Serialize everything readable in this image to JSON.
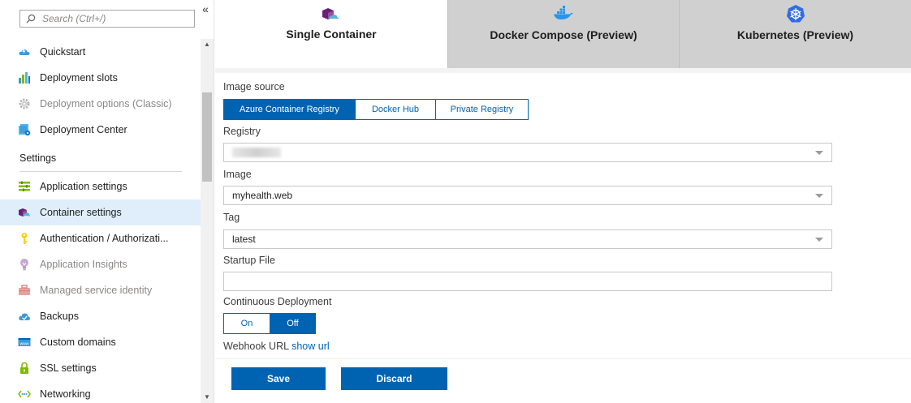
{
  "search": {
    "placeholder": "Search (Ctrl+/)"
  },
  "sidebar": {
    "items_top": [
      {
        "label": "Quickstart",
        "icon": "cloud-lightning-icon",
        "disabled": false
      },
      {
        "label": "Deployment slots",
        "icon": "chart-bars-icon",
        "disabled": false
      },
      {
        "label": "Deployment options (Classic)",
        "icon": "gear-icon",
        "disabled": true
      },
      {
        "label": "Deployment Center",
        "icon": "deployment-center-icon",
        "disabled": false
      }
    ],
    "section_settings": "Settings",
    "items_settings": [
      {
        "label": "Application settings",
        "icon": "list-settings-icon",
        "disabled": false
      },
      {
        "label": "Container settings",
        "icon": "container-icon",
        "disabled": false,
        "selected": true
      },
      {
        "label": "Authentication / Authorizati...",
        "icon": "key-icon",
        "disabled": false
      },
      {
        "label": "Application Insights",
        "icon": "lightbulb-icon",
        "disabled": true
      },
      {
        "label": "Managed service identity",
        "icon": "toolbox-icon",
        "disabled": true
      },
      {
        "label": "Backups",
        "icon": "cloud-backup-icon",
        "disabled": false
      },
      {
        "label": "Custom domains",
        "icon": "www-icon",
        "disabled": false
      },
      {
        "label": "SSL settings",
        "icon": "lock-icon",
        "disabled": false
      },
      {
        "label": "Networking",
        "icon": "networking-icon",
        "disabled": false
      }
    ]
  },
  "tabs": [
    {
      "label": "Single Container",
      "icon": "container-icon",
      "active": true
    },
    {
      "label": "Docker Compose (Preview)",
      "icon": "docker-whale-icon",
      "active": false
    },
    {
      "label": "Kubernetes (Preview)",
      "icon": "kubernetes-helm-icon",
      "active": false
    }
  ],
  "form": {
    "image_source_label": "Image source",
    "image_source_options": [
      "Azure Container Registry",
      "Docker Hub",
      "Private Registry"
    ],
    "image_source_selected": "Azure Container Registry",
    "registry_label": "Registry",
    "registry_value": "",
    "image_label": "Image",
    "image_value": "myhealth.web",
    "tag_label": "Tag",
    "tag_value": "latest",
    "startup_file_label": "Startup File",
    "startup_file_value": "",
    "continuous_deployment_label": "Continuous Deployment",
    "continuous_options": [
      "On",
      "Off"
    ],
    "continuous_selected": "Off",
    "webhook_label": "Webhook URL",
    "webhook_link": "show url"
  },
  "footer": {
    "save_label": "Save",
    "discard_label": "Discard"
  },
  "colors": {
    "accent": "#0063b1",
    "selected_row": "#dfeefa",
    "inactive_tab": "#d0d0d0"
  }
}
